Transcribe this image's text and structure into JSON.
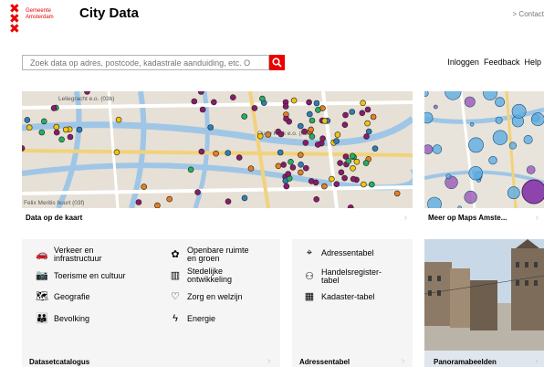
{
  "header": {
    "logo_text_line1": "Gemeente",
    "logo_text_line2": "Amsterdam",
    "title": "City Data",
    "contact": "> Contact"
  },
  "search": {
    "placeholder": "Zoek data op adres, postcode, kadastrale aanduiding, etc. O"
  },
  "nav": [
    "Inloggen",
    "Feedback",
    "Help"
  ],
  "map_tile": {
    "caption": "Data op de kaart",
    "street_labels": [
      "Leliegracht e.o. (03b)",
      "Oude Kerk e.o. (03e)",
      "Felix Meritis buurt (03f)"
    ]
  },
  "maps_tile": {
    "caption": "Meer op Maps Amste..."
  },
  "catalog": {
    "caption": "Datasetcatalogus",
    "items": [
      {
        "icon": "car-icon",
        "label_line1": "Verkeer en",
        "label_line2": "infrastructuur"
      },
      {
        "icon": "camera-icon",
        "label_line1": "Toerisme en cultuur",
        "label_line2": ""
      },
      {
        "icon": "map-icon",
        "label_line1": "Geografie",
        "label_line2": ""
      },
      {
        "icon": "people-icon",
        "label_line1": "Bevolking",
        "label_line2": ""
      },
      {
        "icon": "tree-icon",
        "label_line1": "Openbare ruimte",
        "label_line2": "en groen"
      },
      {
        "icon": "city-icon",
        "label_line1": "Stedelijke",
        "label_line2": "ontwikkeling"
      },
      {
        "icon": "heart-icon",
        "label_line1": "Zorg en welzijn",
        "label_line2": ""
      },
      {
        "icon": "lightning-icon",
        "label_line1": "Energie",
        "label_line2": ""
      }
    ]
  },
  "address": {
    "caption": "Adressentabel",
    "items": [
      {
        "icon": "pin-icon",
        "label_line1": "Adressentabel",
        "label_line2": ""
      },
      {
        "icon": "handshake-icon",
        "label_line1": "Handelsregister-",
        "label_line2": "tabel"
      },
      {
        "icon": "cadastre-icon",
        "label_line1": "Kadaster-tabel",
        "label_line2": ""
      }
    ]
  },
  "panorama": {
    "caption": "Panoramabeelden"
  },
  "colors": {
    "brand_red": "#ec0000",
    "dot_purple": "#8b1a6b"
  }
}
